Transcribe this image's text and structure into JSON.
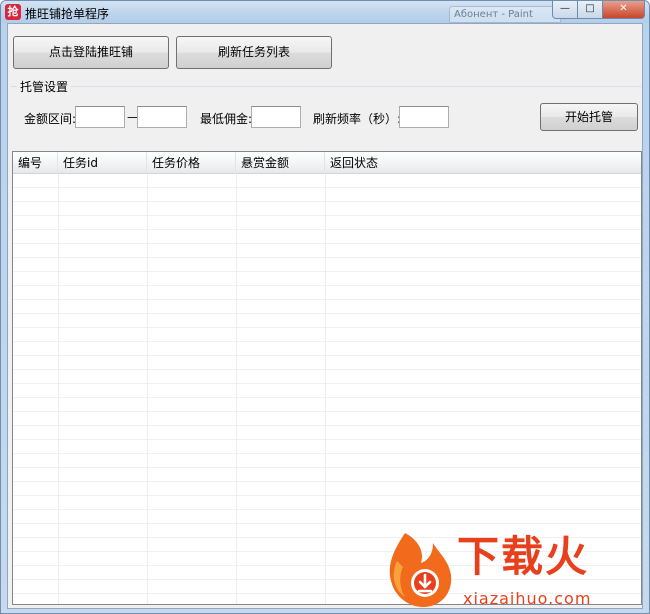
{
  "window": {
    "title": "推旺铺抢单程序",
    "icon_glyph": "抢",
    "background_tab_text": "Абонент - Paint",
    "buttons": {
      "minimize": "—",
      "maximize": "□",
      "close": "✕"
    }
  },
  "toolbar": {
    "login_label": "点击登陆推旺铺",
    "refresh_label": "刷新任务列表"
  },
  "settings": {
    "group_title": "托管设置",
    "amount_range_label": "金额区间:",
    "amount_min": "",
    "range_dash": "—",
    "amount_max": "",
    "min_commission_label": "最低佣金:",
    "min_commission": "",
    "refresh_rate_label": "刷新频率（秒）:",
    "refresh_rate": "",
    "start_label": "开始托管"
  },
  "table": {
    "columns": [
      "编号",
      "任务id",
      "任务价格",
      "悬赏金额",
      "返回状态"
    ],
    "rows": []
  },
  "watermark": {
    "cn": "下载火",
    "en": "xiazaihuo.com"
  },
  "colors": {
    "brand_red": "#e8401c",
    "titlebar": "#c6d9ee",
    "client_bg": "#f0f0f0"
  }
}
